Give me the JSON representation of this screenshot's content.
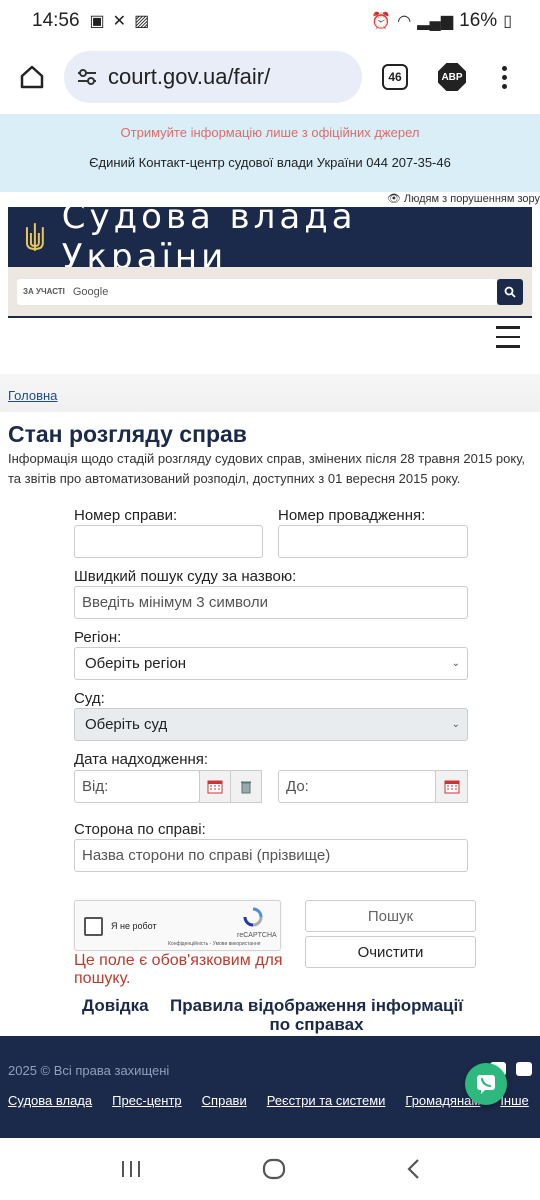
{
  "status_bar": {
    "time": "14:56",
    "battery": "16%"
  },
  "browser": {
    "url": "court.gov.ua/fair/",
    "tab_count": "46",
    "adblock_label": "ABP"
  },
  "banner": {
    "warning": "Отримуйте інформацію лише з офіційних джерел",
    "contact": "Єдиний Контакт-центр судової влади України 044 207-35-46"
  },
  "accessibility_link": "👁 Людям з порушенням зору",
  "header": {
    "site_title": "Судова влада України"
  },
  "search": {
    "prefix": "ЗА УЧАСТІ",
    "brand": "Google"
  },
  "breadcrumb": {
    "home": "Головна"
  },
  "page": {
    "title": "Стан розгляду справ",
    "description": "Інформація щодо стадій розгляду судових справ, змінених після 28 травня 2015 року, та звітів про автоматизований розподіл, доступних з 01 вересня 2015 року."
  },
  "form": {
    "case_number_label": "Номер справи:",
    "case_number_value": "",
    "proceeding_number_label": "Номер провадження:",
    "proceeding_number_value": "",
    "court_search_label": "Швидкий пошук суду за назвою:",
    "court_search_placeholder": "Введіть мінімум 3 символи",
    "region_label": "Регіон:",
    "region_selected": "Оберіть регіон",
    "court_label": "Суд:",
    "court_selected": "Оберіть суд",
    "date_label": "Дата надходження:",
    "date_from_placeholder": "Від:",
    "date_to_placeholder": "До:",
    "party_label": "Сторона по справі:",
    "party_placeholder": "Назва сторони по справі (прізвище)",
    "captcha_text": "Я не робот",
    "captcha_brand": "reCAPTCHA",
    "captcha_privacy": "Конфіденційність - Умови використання",
    "required_error": "Це поле є обов'язковим для пошуку.",
    "search_button": "Пошук",
    "clear_button": "Очистити"
  },
  "links": {
    "help": "Довідка",
    "display_rules": "Правила відображення інформації по справах"
  },
  "footer": {
    "copyright": "2025 © Всі права захищені",
    "nav": [
      "Судова влада",
      "Прес-центр",
      "Справи",
      "Реєстри та системи",
      "Громадянам",
      "Інше"
    ]
  },
  "colors": {
    "navy": "#1b2a4a",
    "banner_bg": "#d9eef6",
    "warning": "#e26a6a",
    "error": "#c0392b",
    "chat": "#2db87e"
  }
}
